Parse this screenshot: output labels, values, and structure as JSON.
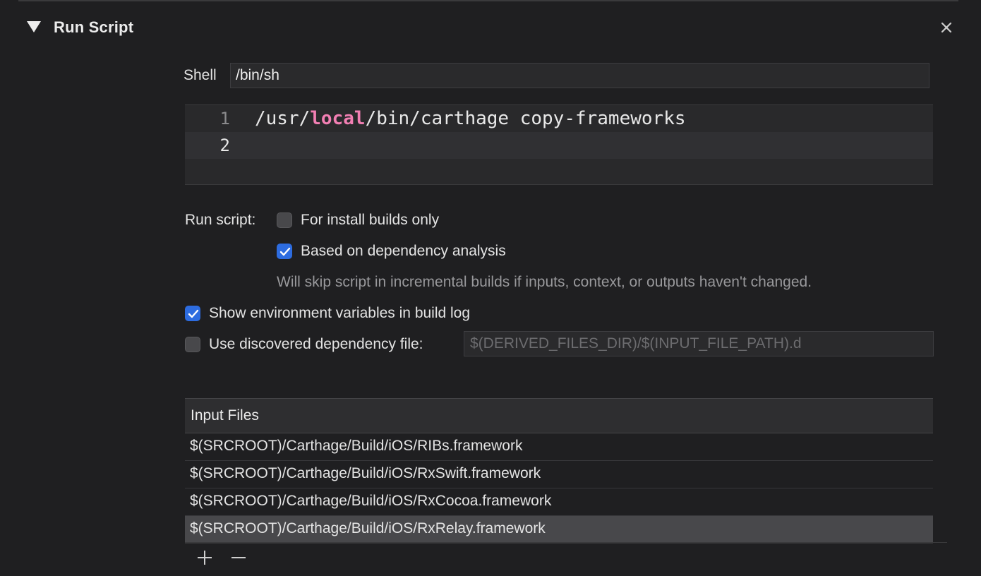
{
  "section": {
    "title": "Run Script",
    "disclosure_icon": "triangle-down-icon",
    "close_icon": "close-icon"
  },
  "shell": {
    "label": "Shell",
    "value": "/bin/sh"
  },
  "editor": {
    "lines": [
      {
        "number": "1",
        "segments": [
          "/usr/",
          "local",
          "/bin/carthage copy-frameworks"
        ]
      },
      {
        "number": "2",
        "segments": [
          "",
          "",
          ""
        ]
      }
    ],
    "keyword_color": "#f27fb3"
  },
  "options": {
    "run_script_label": "Run script:",
    "install_builds_only": {
      "label": "For install builds only",
      "checked": false
    },
    "dependency_analysis": {
      "label": "Based on dependency analysis",
      "checked": true
    },
    "dependency_hint": "Will skip script in incremental builds if inputs, context, or outputs haven't changed.",
    "show_env_vars": {
      "label": "Show environment variables in build log",
      "checked": true
    },
    "use_dep_file": {
      "label": "Use discovered dependency file:",
      "checked": false
    },
    "dep_file_placeholder": "$(DERIVED_FILES_DIR)/$(INPUT_FILE_PATH).d"
  },
  "input_files": {
    "header": "Input Files",
    "rows": [
      "$(SRCROOT)/Carthage/Build/iOS/RIBs.framework",
      "$(SRCROOT)/Carthage/Build/iOS/RxSwift.framework",
      "$(SRCROOT)/Carthage/Build/iOS/RxCocoa.framework",
      "$(SRCROOT)/Carthage/Build/iOS/RxRelay.framework"
    ],
    "selected_index": 3,
    "add_icon": "plus-icon",
    "remove_icon": "minus-icon"
  },
  "colors": {
    "background": "#1f1f21",
    "checkbox_checked": "#2d6ce0",
    "selected_row": "#48484b"
  }
}
